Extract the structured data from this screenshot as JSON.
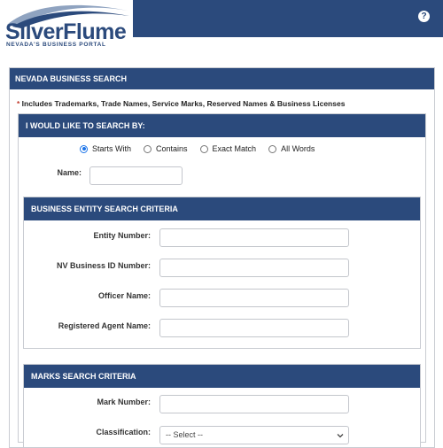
{
  "header": {
    "brand": "SilverFlume",
    "tagline": "NEVADA'S BUSINESS PORTAL",
    "help_glyph": "?"
  },
  "search_panel": {
    "title": "NEVADA BUSINESS SEARCH",
    "note_asterisk": "*",
    "note": " Includes Trademarks, Trade Names, Service Marks, Reserved Names & Business Licenses"
  },
  "search_by": {
    "title": "I WOULD LIKE TO SEARCH BY:",
    "options": [
      {
        "label": "Starts With",
        "selected": true
      },
      {
        "label": "Contains",
        "selected": false
      },
      {
        "label": "Exact Match",
        "selected": false
      },
      {
        "label": "All Words",
        "selected": false
      }
    ],
    "name_label": "Name:",
    "name_value": ""
  },
  "entity_criteria": {
    "title": "BUSINESS ENTITY SEARCH CRITERIA",
    "fields": [
      {
        "label": "Entity Number:",
        "value": ""
      },
      {
        "label": "NV Business ID Number:",
        "value": ""
      },
      {
        "label": "Officer Name:",
        "value": ""
      },
      {
        "label": "Registered Agent Name:",
        "value": ""
      }
    ]
  },
  "marks_criteria": {
    "title": "MARKS SEARCH CRITERIA",
    "mark_number_label": "Mark Number:",
    "mark_number_value": "",
    "classification_label": "Classification:",
    "classification_selected": "-- Select --"
  },
  "colors": {
    "header_blue": "#2b4a7c",
    "radio_accent": "#1a73e8"
  }
}
